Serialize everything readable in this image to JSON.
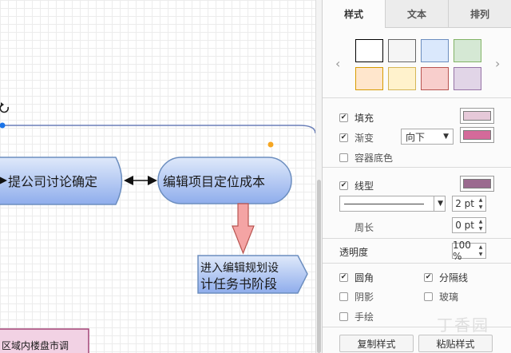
{
  "canvas": {
    "shapes": {
      "discuss": "提公司讨论确定",
      "edit_cost": "编辑项目定位成本",
      "enter_line1": "进入编辑规划设",
      "enter_line2": "计任务书阶段",
      "market": "区域内楼盘市调"
    },
    "colors": {
      "blue_fill_top": "#dfe9fa",
      "blue_fill_bottom": "#8fadec",
      "blue_stroke": "#6c8ebf",
      "red_arrow_fill": "#f4a4a4",
      "red_arrow_stroke": "#b85450",
      "pink_fill": "#f2d2e4",
      "pink_stroke": "#a34476",
      "selection": "#1a73e8",
      "orange_handle": "#f5a623"
    }
  },
  "panel": {
    "tabs": [
      {
        "label": "样式",
        "active": true
      },
      {
        "label": "文本",
        "active": false
      },
      {
        "label": "排列",
        "active": false
      }
    ],
    "swatches": [
      "#ffffff",
      "#f5f5f5",
      "#dae8fc",
      "#d5e8d4",
      "#ffe6cc",
      "#fff2cc",
      "#f8cecc",
      "#e1d5e7"
    ],
    "swatch_borders": [
      "#000000",
      "#666666",
      "#6c8ebf",
      "#82b366",
      "#d79b00",
      "#d6b656",
      "#b85450",
      "#9673a6"
    ],
    "fill": {
      "label": "填充",
      "checked": true,
      "color": "#e6c9d9"
    },
    "gradient": {
      "label": "渐变",
      "checked": true,
      "direction": "向下",
      "color": "#d46a9a"
    },
    "container_bg": {
      "label": "容器底色",
      "checked": false
    },
    "line": {
      "label": "线型",
      "checked": true,
      "color": "#9b6a8f",
      "width": "2 pt"
    },
    "perimeter": {
      "label": "周长",
      "value": "0 pt"
    },
    "opacity": {
      "label": "透明度",
      "value": "100 %"
    },
    "rounded": {
      "label": "圆角",
      "checked": true
    },
    "divider": {
      "label": "分隔线",
      "checked": true
    },
    "shadow": {
      "label": "阴影",
      "checked": false
    },
    "glass": {
      "label": "玻璃",
      "checked": false
    },
    "sketch": {
      "label": "手绘",
      "checked": false
    },
    "copy_style": "复制样式",
    "paste_style": "粘贴样式",
    "watermark": "丁香园"
  }
}
